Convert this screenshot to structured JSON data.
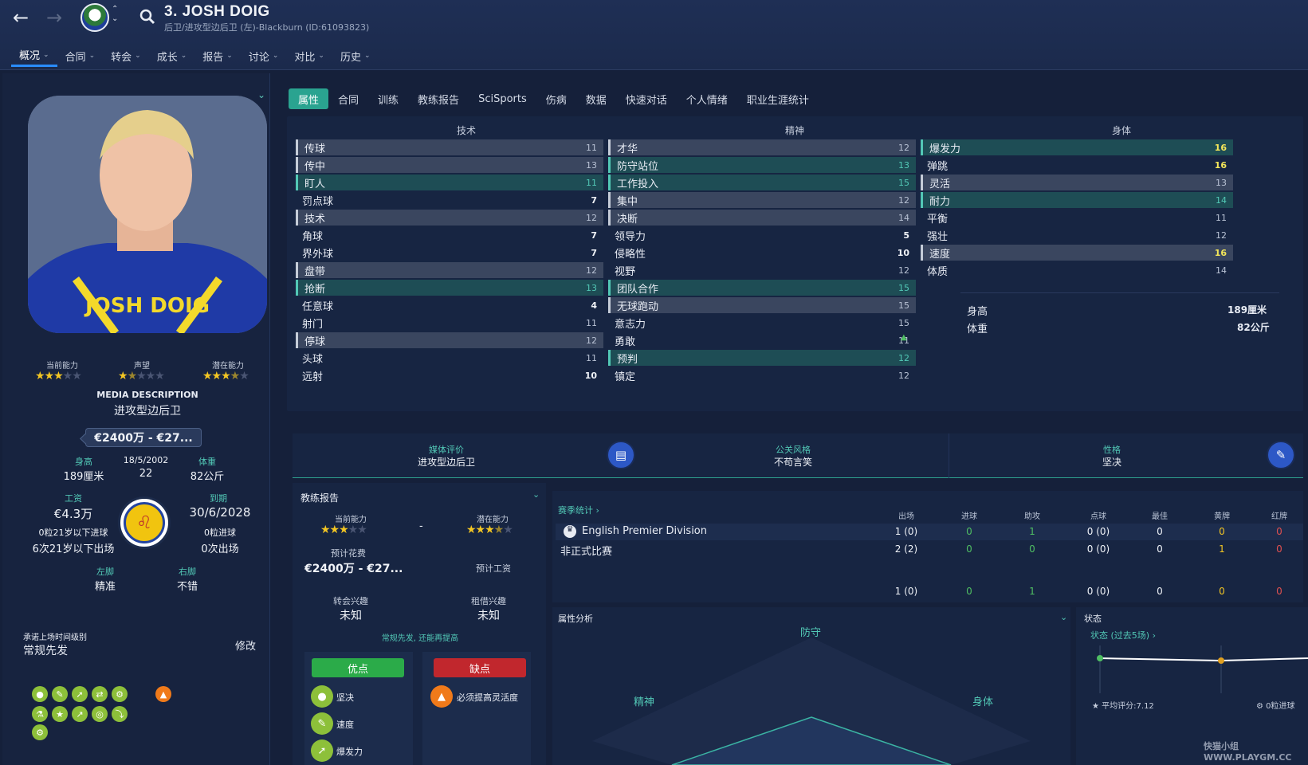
{
  "header": {
    "player_name": "3. JOSH DOIG",
    "subtitle": "后卫/进攻型边后卫 (左)-Blackburn (ID:61093823)",
    "nav": [
      "概况",
      "合同",
      "转会",
      "成长",
      "报告",
      "讨论",
      "对比",
      "历史"
    ]
  },
  "left": {
    "ability_labels": [
      "当前能力",
      "声望",
      "潜在能力"
    ],
    "stars": {
      "current": 3,
      "reputation": 1.5,
      "potential": 3.5
    },
    "media_desc_title": "MEDIA DESCRIPTION",
    "media_desc": "进攻型边后卫",
    "value": "€2400万 - €27...",
    "height_label": "身高",
    "height": "189厘米",
    "dob": "18/5/2002",
    "age": "22",
    "weight_label": "体重",
    "weight": "82公斤",
    "wage_label": "工资",
    "wage": "€4.3万",
    "expiry_label": "到期",
    "expiry": "30/6/2028",
    "u21_goals": "0粒21岁以下进球",
    "u21_apps": "6次21岁以下出场",
    "goals": "0粒进球",
    "apps": "0次出场",
    "left_foot_label": "左脚",
    "left_foot": "精准",
    "right_foot_label": "右脚",
    "right_foot": "不错",
    "playing_time_label": "承诺上场时间级别",
    "playing_time": "常规先发",
    "edit": "修改"
  },
  "tabs": [
    "属性",
    "合同",
    "训练",
    "教练报告",
    "SciSports",
    "伤病",
    "数据",
    "快速对话",
    "个人情绪",
    "职业生涯统计"
  ],
  "attributes": {
    "technical_title": "技术",
    "mental_title": "精神",
    "physical_title": "身体",
    "technical": [
      {
        "n": "传球",
        "v": "11"
      },
      {
        "n": "传中",
        "v": "13"
      },
      {
        "n": "盯人",
        "v": "11"
      },
      {
        "n": "罚点球",
        "v": "7"
      },
      {
        "n": "技术",
        "v": "12"
      },
      {
        "n": "角球",
        "v": "7"
      },
      {
        "n": "界外球",
        "v": "7"
      },
      {
        "n": "盘带",
        "v": "12"
      },
      {
        "n": "抢断",
        "v": "13"
      },
      {
        "n": "任意球",
        "v": "4"
      },
      {
        "n": "射门",
        "v": "11"
      },
      {
        "n": "停球",
        "v": "12"
      },
      {
        "n": "头球",
        "v": "11"
      },
      {
        "n": "远射",
        "v": "10"
      }
    ],
    "mental": [
      {
        "n": "才华",
        "v": "12"
      },
      {
        "n": "防守站位",
        "v": "13"
      },
      {
        "n": "工作投入",
        "v": "15"
      },
      {
        "n": "集中",
        "v": "12"
      },
      {
        "n": "决断",
        "v": "14"
      },
      {
        "n": "领导力",
        "v": "5"
      },
      {
        "n": "侵略性",
        "v": "10"
      },
      {
        "n": "视野",
        "v": "12"
      },
      {
        "n": "团队合作",
        "v": "15"
      },
      {
        "n": "无球跑动",
        "v": "15"
      },
      {
        "n": "意志力",
        "v": "15"
      },
      {
        "n": "勇敢",
        "v": "11"
      },
      {
        "n": "预判",
        "v": "12"
      },
      {
        "n": "镇定",
        "v": "12"
      }
    ],
    "physical": [
      {
        "n": "爆发力",
        "v": "16"
      },
      {
        "n": "弹跳",
        "v": "16"
      },
      {
        "n": "灵活",
        "v": "13"
      },
      {
        "n": "耐力",
        "v": "14"
      },
      {
        "n": "平衡",
        "v": "11"
      },
      {
        "n": "强壮",
        "v": "12"
      },
      {
        "n": "速度",
        "v": "16"
      },
      {
        "n": "体质",
        "v": "14"
      }
    ],
    "height_label": "身高",
    "height": "189厘米",
    "weight_label": "体重",
    "weight": "82公斤"
  },
  "summary": {
    "media_label": "媒体评价",
    "media_value": "进攻型边后卫",
    "pr_label": "公关风格",
    "pr_value": "不苟言笑",
    "personality_label": "性格",
    "personality_value": "坚决"
  },
  "coach_report": {
    "title": "教练报告",
    "current_label": "当前能力",
    "potential_label": "潜在能力",
    "dash": "-",
    "fee_label": "预计花费",
    "fee": "€2400万 - €27...",
    "wage_label": "预计工资",
    "transfer_label": "转会兴趣",
    "transfer": "未知",
    "loan_label": "租借兴趣",
    "loan": "未知",
    "note": "常规先发, 还能再提高",
    "pros_label": "优点",
    "cons_label": "缺点",
    "pros": [
      "坚决",
      "速度",
      "爆发力"
    ],
    "cons": [
      "必须提高灵活度"
    ]
  },
  "season": {
    "title": "赛季统计 ›",
    "headers": [
      "出场",
      "进球",
      "助攻",
      "点球",
      "最佳",
      "黄牌",
      "红牌"
    ],
    "rows": [
      {
        "comp": "English Premier Division",
        "vals": [
          "1 (0)",
          "0",
          "1",
          "0 (0)",
          "0",
          "0",
          "0"
        ]
      },
      {
        "comp": "非正式比赛",
        "vals": [
          "2 (2)",
          "0",
          "0",
          "0 (0)",
          "0",
          "1",
          "0"
        ]
      }
    ],
    "total": [
      "1 (0)",
      "0",
      "1",
      "0 (0)",
      "0",
      "0",
      "0"
    ]
  },
  "analysis": {
    "title": "属性分析",
    "defense": "防守",
    "mental": "精神",
    "physical": "身体"
  },
  "form": {
    "title": "状态",
    "subtitle": "状态 (过去5场) ›",
    "avg": "平均评分:7.12",
    "goals": "0粒进球"
  },
  "watermark": "快猫小组 WWW.PLAYGM.CC"
}
